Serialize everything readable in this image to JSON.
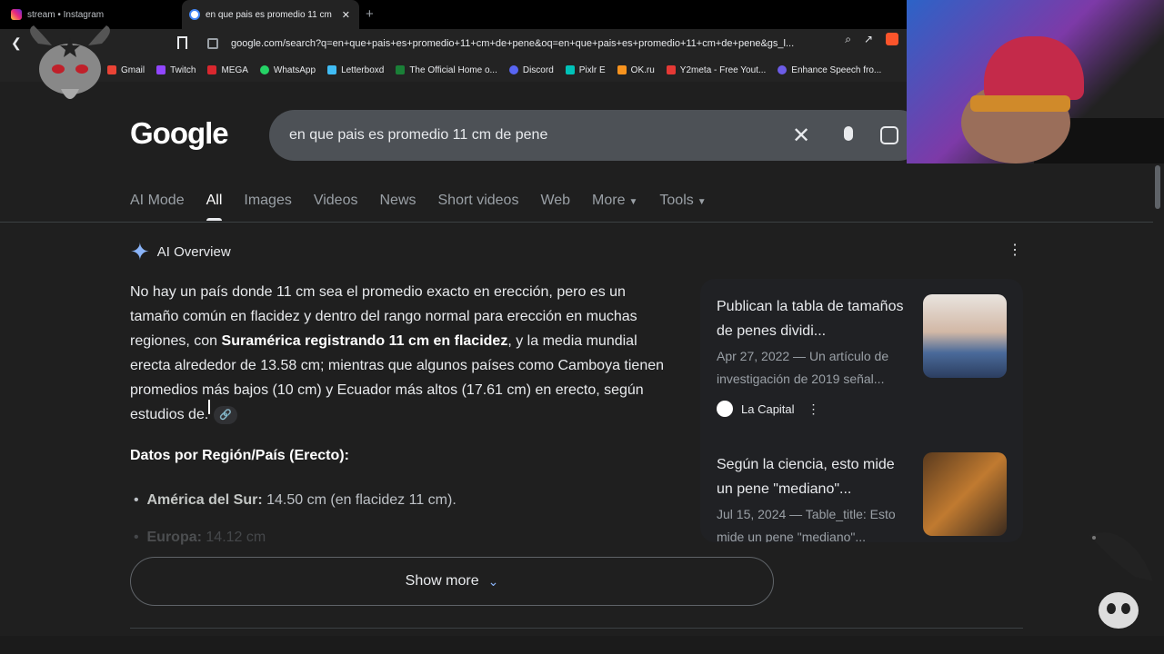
{
  "browser": {
    "tabs": [
      {
        "title": "stream • Instagram",
        "active": false
      },
      {
        "title": "en que pais es promedio 11 cm",
        "active": true
      }
    ],
    "url": "google.com/search?q=en+que+pais+es+promedio+11+cm+de+pene&oq=en+que+pais+es+promedio+11+cm+de+pene&gs_l...",
    "bookmarks": [
      {
        "label": "Gmail",
        "color": "#ea4335"
      },
      {
        "label": "Twitch",
        "color": "#9146ff"
      },
      {
        "label": "MEGA",
        "color": "#d9272e"
      },
      {
        "label": "WhatsApp",
        "color": "#25d366"
      },
      {
        "label": "Letterboxd",
        "color": "#40bcf4"
      },
      {
        "label": "The Official Home o...",
        "color": "#1a7f37"
      },
      {
        "label": "Discord",
        "color": "#5865f2"
      },
      {
        "label": "Pixlr E",
        "color": "#00c2b8"
      },
      {
        "label": "OK.ru",
        "color": "#f7931e"
      },
      {
        "label": "Y2meta - Free Yout...",
        "color": "#e53935"
      },
      {
        "label": "Enhance Speech fro...",
        "color": "#6c5ce7"
      }
    ]
  },
  "google": {
    "logo": "Google",
    "query": "en que pais es promedio 11 cm de pene",
    "nav": [
      {
        "label": "AI Mode",
        "active": false
      },
      {
        "label": "All",
        "active": true
      },
      {
        "label": "Images",
        "active": false
      },
      {
        "label": "Videos",
        "active": false
      },
      {
        "label": "News",
        "active": false
      },
      {
        "label": "Short videos",
        "active": false
      },
      {
        "label": "Web",
        "active": false
      },
      {
        "label": "More",
        "active": false
      },
      {
        "label": "Tools",
        "active": false
      }
    ],
    "ai_overview": {
      "title": "AI Overview",
      "p1_a": "No hay un país donde 11 cm sea el promedio exacto en erección, pero es un tamaño común en flacidez y dentro del rango normal para erección en muchas regiones, con ",
      "p1_bold": "Suramérica registrando 11 cm en flacidez",
      "p1_b": ", y la media mundial erecta alrededor de 13.58 cm; mientras que algunos países como Camboya tienen promedios más bajos (10 cm) y Ecuador más altos (17.61 cm) en erecto, según estudios de.",
      "heading": "Datos por Región/País (Erecto):",
      "bullets": [
        {
          "label": "América del Sur:",
          "text": " 14.50 cm (en flacidez 11 cm)."
        },
        {
          "label": "Europa:",
          "text": " 14.12 cm"
        }
      ],
      "show_more": "Show more"
    },
    "sources": [
      {
        "title": "Publican la tabla de tamaños de penes dividi...",
        "desc": "Apr 27, 2022 — Un artículo de investigación de 2019 señal...",
        "publisher": "La Capital"
      },
      {
        "title": "Según la ciencia, esto mide un pene \"mediano\"...",
        "desc": "Jul 15, 2024 — Table_title: Esto mide un pene \"mediano\"...",
        "publisher": ""
      }
    ]
  },
  "colors": {
    "background": "#1f1f1f",
    "accent": "#8ab4f8",
    "searchbox": "#4d5156"
  }
}
